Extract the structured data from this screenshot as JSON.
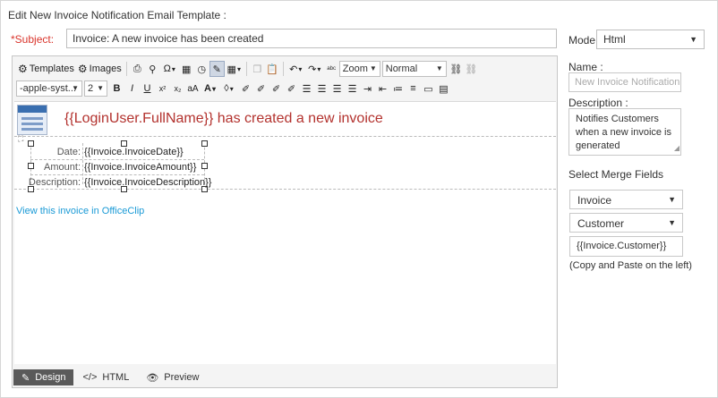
{
  "page": {
    "title": "Edit New Invoice Notification Email Template :",
    "subject_label": "*Subject:",
    "subject_value": "Invoice: A new invoice has been created",
    "mode_label": "Mode:",
    "mode_value": "Html"
  },
  "toolbar": {
    "templates_label": "Templates",
    "images_label": "Images",
    "zoom_label": "Zoom",
    "paragraph_value": "Normal",
    "font_value": "-apple-syst...",
    "size_value": "2",
    "bold_label": "B",
    "italic_label": "I",
    "underline_label": "U",
    "superscript_label": "x²",
    "subscript_label": "x₂",
    "case_label": "aA",
    "font_color_label": "A",
    "icons": {
      "templates": "gear-icon",
      "images": "gear-icon",
      "print": "print-icon",
      "find": "binoculars-icon",
      "special_chars": "omega-icon",
      "date": "calendar-icon",
      "time": "clock-icon",
      "design_toggle": "pencil-icon",
      "table": "table-icon",
      "copy": "copy-icon",
      "paste": "paste-icon",
      "undo": "undo-icon",
      "redo": "redo-icon",
      "spell": "spellcheck-icon",
      "link": "link-icon",
      "unlink": "unlink-icon",
      "highlight": "drop-icon",
      "align_left": "align-left-icon",
      "align_center": "align-center-icon",
      "align_right": "align-right-icon",
      "justify": "justify-icon",
      "indent": "indent-icon",
      "outdent": "outdent-icon",
      "ordered_list": "ordered-list-icon",
      "bullet_list": "bullet-list-icon",
      "media": "media-icon",
      "document": "document-icon"
    }
  },
  "content": {
    "header_text": "{{LoginUser.FullName}} has created a new invoice",
    "rows": [
      {
        "label": "Date:",
        "value": "{{Invoice.InvoiceDate}}"
      },
      {
        "label": "Amount:",
        "value": "{{Invoice.InvoiceAmount}}"
      },
      {
        "label": "Description:",
        "value": "{{Invoice.InvoiceDescription}}"
      }
    ],
    "link_text": "View this invoice in OfficeClip"
  },
  "modes": {
    "design_label": "Design",
    "html_label": "HTML",
    "preview_label": "Preview"
  },
  "side": {
    "name_label": "Name :",
    "name_placeholder": "New Invoice Notification",
    "description_label": "Description :",
    "description_value": "Notifies Customers when a new invoice is generated",
    "merge_label": "Select Merge Fields",
    "merge_group": "Invoice",
    "merge_entity": "Customer",
    "merge_output": "{{Invoice.Customer}}",
    "copy_note": "(Copy and Paste on the left)"
  },
  "colors": {
    "required_label": "#d9342b",
    "header_text": "#b3322e",
    "link": "#1a9ad6",
    "active_mode_tab": "#5a5a5a"
  }
}
